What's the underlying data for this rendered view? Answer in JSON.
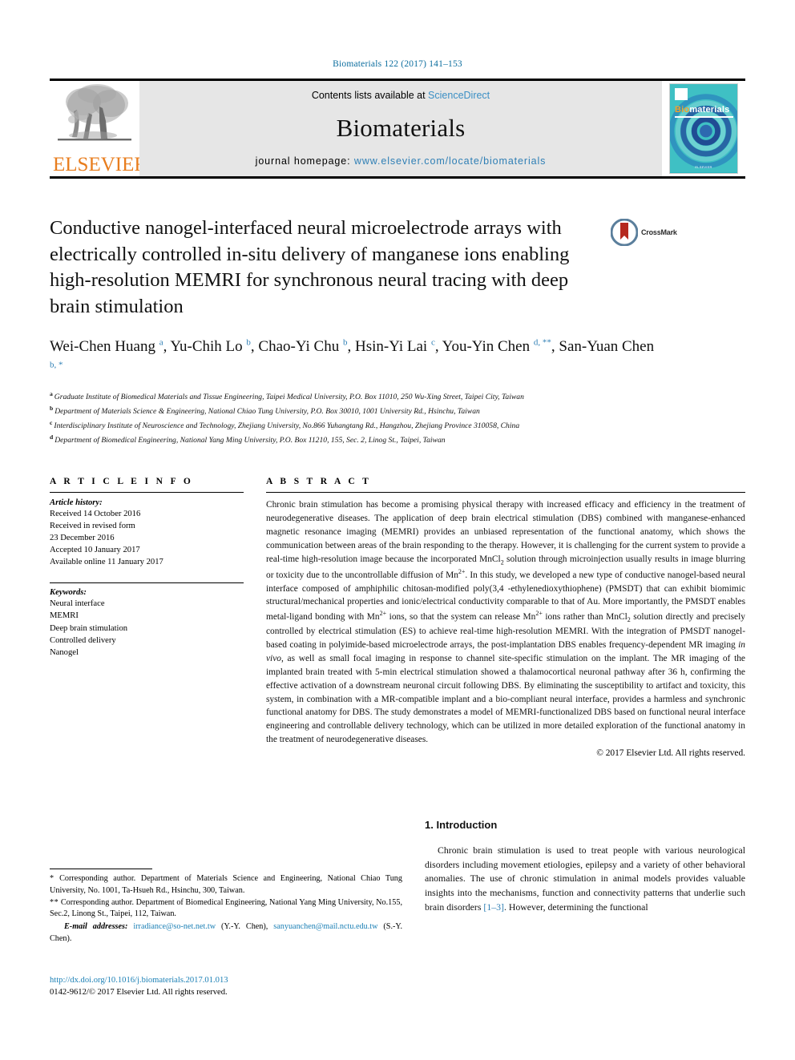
{
  "running_head": "Biomaterials 122 (2017) 141–153",
  "banner": {
    "publisher_name": "ELSEVIER",
    "contents_prefix": "Contents lists available at ",
    "contents_link": "ScienceDirect",
    "journal_name": "Biomaterials",
    "homepage_prefix": "journal homepage: ",
    "homepage_url": "www.elsevier.com/locate/biomaterials",
    "cover": {
      "brand_part1": "Bio",
      "brand_part2": "materials",
      "footer": "ELSEVIER"
    }
  },
  "article": {
    "title": "Conductive nanogel-interfaced neural microelectrode arrays with electrically controlled in-situ delivery of manganese ions enabling high-resolution MEMRI for synchronous neural tracing with deep brain stimulation",
    "crossmark_label": "CrossMark"
  },
  "authors": [
    {
      "name": "Wei-Chen Huang",
      "marks": "a",
      "sep": ", "
    },
    {
      "name": "Yu-Chih Lo",
      "marks": "b",
      "sep": ", "
    },
    {
      "name": "Chao-Yi Chu",
      "marks": "b",
      "sep": ", "
    },
    {
      "name": "Hsin-Yi Lai",
      "marks": "c",
      "sep": ", "
    },
    {
      "name": "You-Yin Chen",
      "marks": "d, **",
      "sep": ", "
    },
    {
      "name": "San-Yuan Chen",
      "marks": "b, *",
      "sep": ""
    }
  ],
  "affiliations": [
    {
      "mark": "a",
      "text": "Graduate Institute of Biomedical Materials and Tissue Engineering, Taipei Medical University, P.O. Box 11010, 250 Wu-Xing Street, Taipei City, Taiwan"
    },
    {
      "mark": "b",
      "text": "Department of Materials Science & Engineering, National Chiao Tung University, P.O. Box 30010, 1001 University Rd., Hsinchu, Taiwan"
    },
    {
      "mark": "c",
      "text": "Interdisciplinary Institute of Neuroscience and Technology, Zhejiang University, No.866 Yuhangtang Rd., Hangzhou, Zhejiang Province 310058, China"
    },
    {
      "mark": "d",
      "text": "Department of Biomedical Engineering, National Yang Ming University, P.O. Box 11210, 155, Sec. 2, Linog St., Taipei, Taiwan"
    }
  ],
  "article_info": {
    "heading": "A R T I C L E  I N F O",
    "history_title": "Article history:",
    "history": [
      "Received 14 October 2016",
      "Received in revised form",
      "23 December 2016",
      "Accepted 10 January 2017",
      "Available online 11 January 2017"
    ],
    "keywords_title": "Keywords:",
    "keywords": [
      "Neural interface",
      "MEMRI",
      "Deep brain stimulation",
      "Controlled delivery",
      "Nanogel"
    ]
  },
  "abstract": {
    "heading": "A B S T R A C T",
    "paragraph_parts": [
      {
        "t": "Chronic brain stimulation has become a promising physical therapy with increased efficacy and efficiency in the treatment of neurodegenerative diseases. The application of deep brain electrical stimulation (DBS) combined with manganese-enhanced magnetic resonance imaging (MEMRI) provides an unbiased representation of the functional anatomy, which shows the communication between areas of the brain responding to the therapy. However, it is challenging for the current system to provide a real-time high-resolution image because the incorporated MnCl"
      },
      {
        "t": "2",
        "style": "sub"
      },
      {
        "t": " solution through microinjection usually results in image blurring or toxicity due to the uncontrollable diffusion of Mn"
      },
      {
        "t": "2+",
        "style": "sup"
      },
      {
        "t": ". In this study, we developed a new type of conductive nanogel-based neural interface composed of amphiphilic chitosan-modified poly(3,4 -ethylenedioxythiophene) (PMSDT) that can exhibit biomimic structural/mechanical properties and ionic/electrical conductivity comparable to that of Au. More importantly, the PMSDT enables metal-ligand bonding with Mn"
      },
      {
        "t": "2+",
        "style": "sup"
      },
      {
        "t": " ions, so that the system can release Mn"
      },
      {
        "t": "2+",
        "style": "sup"
      },
      {
        "t": " ions rather than MnCl"
      },
      {
        "t": "2",
        "style": "sub"
      },
      {
        "t": " solution directly and precisely controlled by electrical stimulation (ES) to achieve real-time high-resolution MEMRI. With the integration of PMSDT nanogel-based coating in polyimide-based microelectrode arrays, the post-implantation DBS enables frequency-dependent MR imaging "
      },
      {
        "t": "in vivo",
        "style": "italic"
      },
      {
        "t": ", as well as small focal imaging in response to channel site-specific stimulation on the implant. The MR imaging of the implanted brain treated with 5-min electrical stimulation showed a thalamocortical neuronal pathway after 36 h, confirming the effective activation of a downstream neuronal circuit following DBS. By eliminating the susceptibility to artifact and toxicity, this system, in combination with a MR-compatible implant and a bio-compliant neural interface, provides a harmless and synchronic functional anatomy for DBS. The study demonstrates a model of MEMRI-functionalized DBS based on functional neural interface engineering and controllable delivery technology, which can be utilized in more detailed exploration of the functional anatomy in the treatment of neurodegenerative diseases."
      }
    ],
    "copyright": "© 2017 Elsevier Ltd. All rights reserved."
  },
  "introduction": {
    "heading": "1.  Introduction",
    "parts": [
      {
        "t": "Chronic brain stimulation is used to treat people with various neurological disorders including movement etiologies, epilepsy and a variety of other behavioral anomalies. The use of chronic stimulation in animal models provides valuable insights into the mechanisms, function and connectivity patterns that underlie such brain disorders "
      },
      {
        "t": "[1–3]",
        "style": "cite"
      },
      {
        "t": ". However, determining the functional"
      }
    ]
  },
  "footnotes": {
    "corresponding_1_mark": "*",
    "corresponding_1": "Corresponding author. Department of Materials Science and Engineering, National Chiao Tung University, No. 1001, Ta-Hsueh Rd., Hsinchu, 300, Taiwan.",
    "corresponding_2_mark": "**",
    "corresponding_2": "Corresponding author. Department of Biomedical Engineering, National Yang Ming University, No.155, Sec.2, Linong St., Taipei, 112, Taiwan.",
    "email_label": "E-mail addresses:",
    "email_1": "irradiance@so-net.net.tw",
    "email_1_owner": "(Y.-Y. Chen)",
    "email_2": "sanyuanchen@mail.nctu.edu.tw",
    "email_2_owner": "(S.-Y. Chen)."
  },
  "footer": {
    "doi": "http://dx.doi.org/10.1016/j.biomaterials.2017.01.013",
    "issn_line": "0142-9612/© 2017 Elsevier Ltd. All rights reserved."
  },
  "colors": {
    "link_blue": "#1a7fb5",
    "header_blue": "#0b6d9e",
    "elsevier_orange": "#E87D1E",
    "banner_gray": "#e6e6e6",
    "cover_teal": "#2fb8c0"
  }
}
